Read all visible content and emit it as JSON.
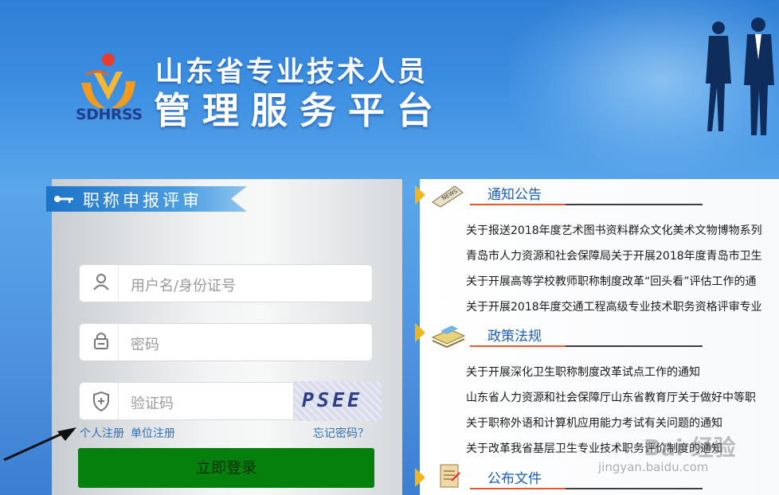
{
  "header": {
    "logo_text": "SDHRSS",
    "title_line1": "山东省专业技术人员",
    "title_line2": "管理服务平台"
  },
  "login": {
    "section_title": "职称申报评审",
    "username_placeholder": "用户名/身份证号",
    "password_placeholder": "密码",
    "captcha_placeholder": "验证码",
    "captcha_text": "PSEE",
    "personal_register": "个人注册",
    "unit_register": "单位注册",
    "forgot_password": "忘记密码？",
    "login_button": "立即登录"
  },
  "news": {
    "sections": [
      {
        "title": "通知公告",
        "icon": "news-icon",
        "items": [
          "关于报送2018年度艺术图书资料群众文化美术文物博物系列",
          "青岛市人力资源和社会保障局关于开展2018年度青岛市卫生",
          "关于开展高等学校教师职称制度改革“回头看”评估工作的通",
          "关于开展2018年度交通工程高级专业技术职务资格评审专业"
        ]
      },
      {
        "title": "政策法规",
        "icon": "books-icon",
        "items": [
          "关于开展深化卫生职称制度改革试点工作的通知",
          "山东省人力资源和社会保障厅山东省教育厅关于做好中等职",
          "关于职称外语和计算机应用能力考试有关问题的通知",
          "关于改革我省基层卫生专业技术职务评价制度的通知"
        ]
      },
      {
        "title": "公布文件",
        "icon": "document-icon",
        "items": []
      }
    ]
  },
  "watermark": {
    "brand": "Bai 经验",
    "url": "jingyan.baidu.com"
  },
  "colors": {
    "login_button": "#06800c",
    "link": "#2f6fb8",
    "section_title": "#1d5db3",
    "accent_line": "#e2582a",
    "marker": "#f1b51f"
  }
}
